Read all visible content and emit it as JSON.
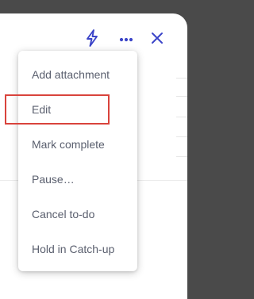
{
  "header": {
    "icons": [
      {
        "name": "lightning-icon",
        "color": "#3b44c8"
      },
      {
        "name": "more-options-icon",
        "color": "#3b44c8"
      },
      {
        "name": "close-icon",
        "color": "#3b44c8"
      }
    ]
  },
  "menu": {
    "items": [
      {
        "label": "Add attachment"
      },
      {
        "label": "Edit"
      },
      {
        "label": "Mark complete"
      },
      {
        "label": "Pause…"
      },
      {
        "label": "Cancel to-do"
      },
      {
        "label": "Hold in Catch-up"
      }
    ],
    "highlighted_item": "Edit",
    "highlight_color": "#d9433c"
  }
}
